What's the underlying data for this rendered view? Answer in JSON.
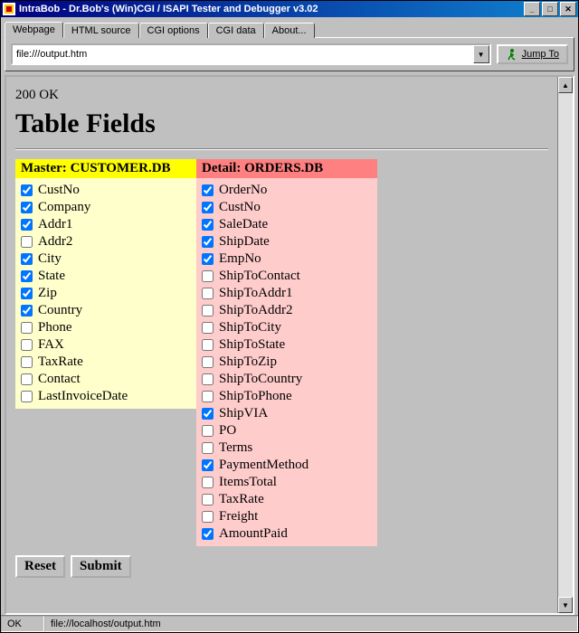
{
  "window": {
    "title": "IntraBob - Dr.Bob's (Win)CGI / ISAPI Tester and Debugger v3.02"
  },
  "tabs": [
    "Webpage",
    "HTML source",
    "CGI options",
    "CGI data",
    "About..."
  ],
  "active_tab": 0,
  "address": {
    "value": "file:///output.htm"
  },
  "jump_label": "Jump To",
  "page": {
    "status_line": "200 OK",
    "heading": "Table Fields",
    "master": {
      "label": "Master:",
      "file": "CUSTOMER.DB",
      "fields": [
        {
          "name": "CustNo",
          "checked": true
        },
        {
          "name": "Company",
          "checked": true
        },
        {
          "name": "Addr1",
          "checked": true
        },
        {
          "name": "Addr2",
          "checked": false
        },
        {
          "name": "City",
          "checked": true
        },
        {
          "name": "State",
          "checked": true
        },
        {
          "name": "Zip",
          "checked": true
        },
        {
          "name": "Country",
          "checked": true
        },
        {
          "name": "Phone",
          "checked": false
        },
        {
          "name": "FAX",
          "checked": false
        },
        {
          "name": "TaxRate",
          "checked": false
        },
        {
          "name": "Contact",
          "checked": false
        },
        {
          "name": "LastInvoiceDate",
          "checked": false
        }
      ]
    },
    "detail": {
      "label": "Detail:",
      "file": "ORDERS.DB",
      "fields": [
        {
          "name": "OrderNo",
          "checked": true
        },
        {
          "name": "CustNo",
          "checked": true
        },
        {
          "name": "SaleDate",
          "checked": true
        },
        {
          "name": "ShipDate",
          "checked": true
        },
        {
          "name": "EmpNo",
          "checked": true
        },
        {
          "name": "ShipToContact",
          "checked": false
        },
        {
          "name": "ShipToAddr1",
          "checked": false
        },
        {
          "name": "ShipToAddr2",
          "checked": false
        },
        {
          "name": "ShipToCity",
          "checked": false
        },
        {
          "name": "ShipToState",
          "checked": false
        },
        {
          "name": "ShipToZip",
          "checked": false
        },
        {
          "name": "ShipToCountry",
          "checked": false
        },
        {
          "name": "ShipToPhone",
          "checked": false
        },
        {
          "name": "ShipVIA",
          "checked": true
        },
        {
          "name": "PO",
          "checked": false
        },
        {
          "name": "Terms",
          "checked": false
        },
        {
          "name": "PaymentMethod",
          "checked": true
        },
        {
          "name": "ItemsTotal",
          "checked": false
        },
        {
          "name": "TaxRate",
          "checked": false
        },
        {
          "name": "Freight",
          "checked": false
        },
        {
          "name": "AmountPaid",
          "checked": true
        }
      ]
    },
    "buttons": {
      "reset": "Reset",
      "submit": "Submit"
    }
  },
  "statusbar": {
    "left": "OK",
    "right": "file://localhost/output.htm"
  }
}
